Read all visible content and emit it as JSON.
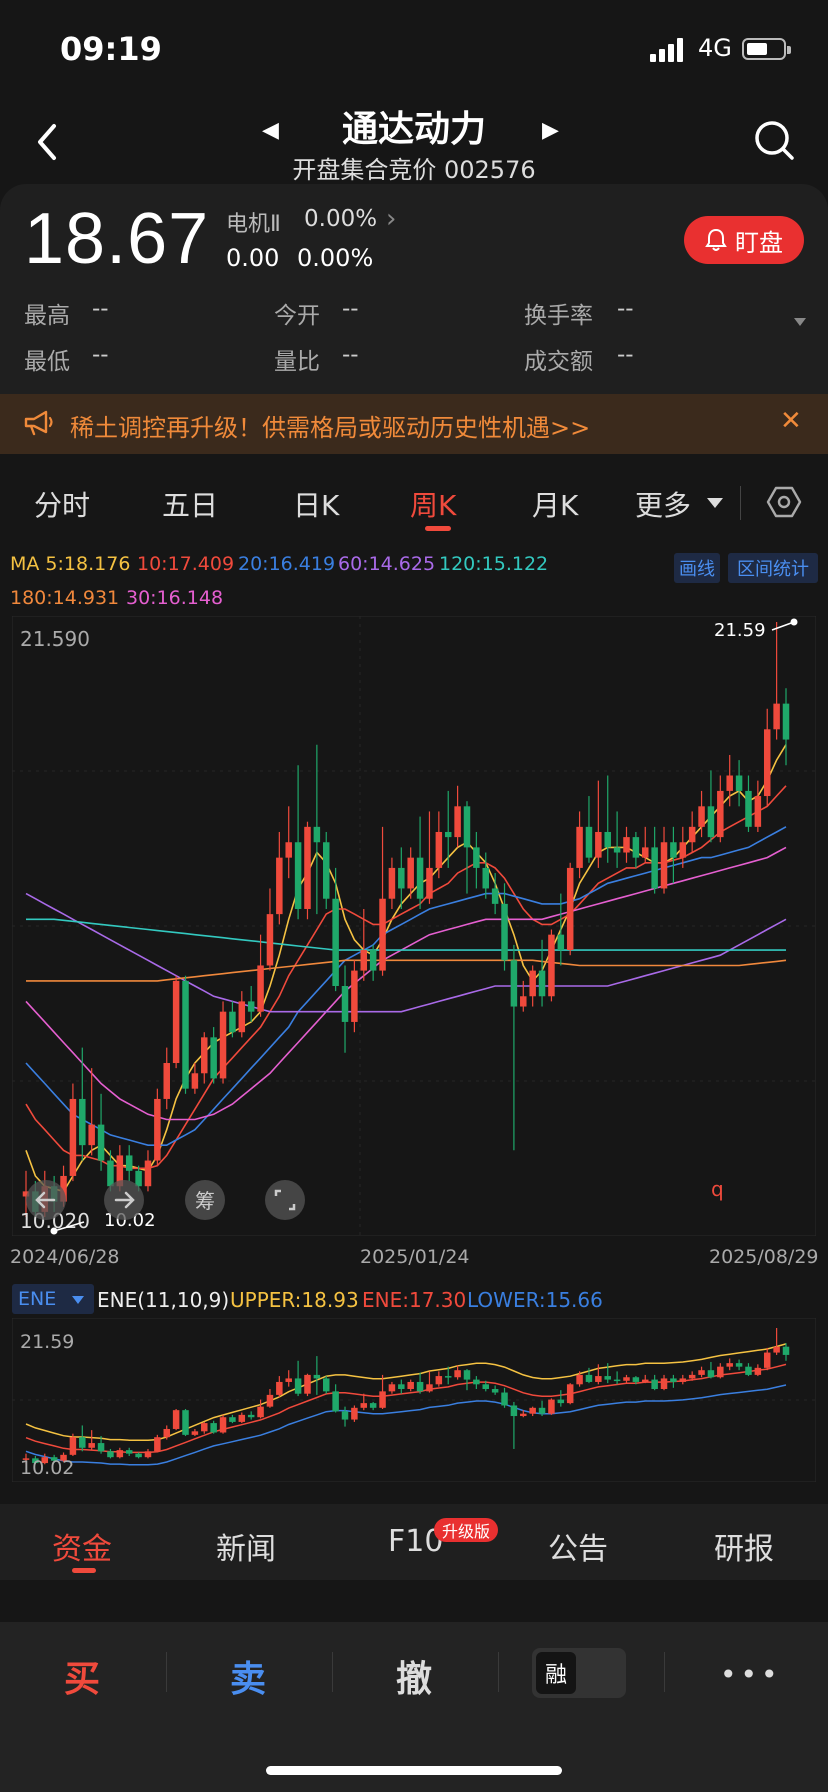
{
  "status_bar": {
    "time": "09:19",
    "network": "4G"
  },
  "header": {
    "title": "通达动力",
    "subtitle": "开盘集合竞价 002576"
  },
  "quote": {
    "price": "18.67",
    "sector_name": "电机Ⅱ",
    "sector_change": "0.00%",
    "change": "0.00",
    "change_pct": "0.00%",
    "watch_button": "盯盘",
    "stats": [
      {
        "label": "最高",
        "value": "--"
      },
      {
        "label": "今开",
        "value": "--"
      },
      {
        "label": "换手率",
        "value": "--"
      },
      {
        "label": "最低",
        "value": "--"
      },
      {
        "label": "量比",
        "value": "--"
      },
      {
        "label": "成交额",
        "value": "--"
      }
    ]
  },
  "banner": {
    "text": "稀土调控再升级！供需格局或驱动历史性机遇>>",
    "close": "✕"
  },
  "period_tabs": [
    "分时",
    "五日",
    "日K",
    "周K",
    "月K",
    "更多"
  ],
  "active_period": "周K",
  "ma_indicators": [
    {
      "label": "MA 5:18.176",
      "color": "#f5c242"
    },
    {
      "label": "10:17.409",
      "color": "#f04a3c"
    },
    {
      "label": "20:16.419",
      "color": "#3a7fe0"
    },
    {
      "label": "60:14.625",
      "color": "#a96ae8"
    },
    {
      "label": "120:15.122",
      "color": "#33c9c0"
    },
    {
      "label": "180:14.931",
      "color": "#f0883c"
    },
    {
      "label": "30:16.148",
      "color": "#e55fd0"
    }
  ],
  "chart_tools": {
    "draw": "画线",
    "range_stats": "区间统计"
  },
  "main_chart_labels": {
    "y_max": "21.590",
    "y_min": "10.020",
    "high_marker": "21.59",
    "low_marker": "10.02",
    "chip_button": "筹",
    "marker_q": "q"
  },
  "dates": [
    "2024/06/28",
    "2025/01/24",
    "2025/08/29"
  ],
  "ene": {
    "select": "ENE",
    "params": "ENE(11,10,9)",
    "upper": "UPPER:18.93",
    "mid": "ENE:17.30",
    "lower": "LOWER:15.66",
    "y_max": "21.59",
    "y_min": "10.02"
  },
  "bottom_tabs": [
    "资金",
    "新闻",
    "F10",
    "公告",
    "研报"
  ],
  "upgrade_badge": "升级版",
  "actions": {
    "buy": "买",
    "sell": "卖",
    "cancel": "撤",
    "margin": "融",
    "more": "•••"
  },
  "colors": {
    "up": "#f04a3c",
    "down": "#1fa86a",
    "accent": "#e93030",
    "link": "#4a8ef0"
  },
  "chart_data": {
    "type": "candlestick",
    "ylim": [
      10.02,
      21.59
    ],
    "candles": [
      [
        10.4,
        10.5,
        10.0,
        10.9
      ],
      [
        10.5,
        10.1,
        10.02,
        10.7
      ],
      [
        10.1,
        10.6,
        10.0,
        10.9
      ],
      [
        10.6,
        10.3,
        10.1,
        10.8
      ],
      [
        10.3,
        10.8,
        10.2,
        11.0
      ],
      [
        10.8,
        12.3,
        10.7,
        12.6
      ],
      [
        12.3,
        11.4,
        11.1,
        13.3
      ],
      [
        11.4,
        11.8,
        11.2,
        12.9
      ],
      [
        11.8,
        11.1,
        10.9,
        12.4
      ],
      [
        11.1,
        10.6,
        10.5,
        11.3
      ],
      [
        10.6,
        11.2,
        10.5,
        11.4
      ],
      [
        11.2,
        10.9,
        10.7,
        11.4
      ],
      [
        10.9,
        10.6,
        10.5,
        11.0
      ],
      [
        10.6,
        11.1,
        10.5,
        11.3
      ],
      [
        11.1,
        12.3,
        11.0,
        12.5
      ],
      [
        12.3,
        13.0,
        12.1,
        13.3
      ],
      [
        13.0,
        14.6,
        12.9,
        14.7
      ],
      [
        14.6,
        12.5,
        12.4,
        14.7
      ],
      [
        12.5,
        12.8,
        12.4,
        13.0
      ],
      [
        12.8,
        13.5,
        12.6,
        13.6
      ],
      [
        13.5,
        12.7,
        12.6,
        13.7
      ],
      [
        12.7,
        14.0,
        12.6,
        14.2
      ],
      [
        14.0,
        13.6,
        13.5,
        14.2
      ],
      [
        13.6,
        14.2,
        13.5,
        14.4
      ],
      [
        14.2,
        14.0,
        13.8,
        14.5
      ],
      [
        14.0,
        14.9,
        13.9,
        15.5
      ],
      [
        14.9,
        15.9,
        14.8,
        16.4
      ],
      [
        15.9,
        17.0,
        15.7,
        17.5
      ],
      [
        17.0,
        17.3,
        16.6,
        18.0
      ],
      [
        17.3,
        16.0,
        15.8,
        18.8
      ],
      [
        16.0,
        17.6,
        15.8,
        17.7
      ],
      [
        17.6,
        17.3,
        15.9,
        19.2
      ],
      [
        17.3,
        16.2,
        16.0,
        17.5
      ],
      [
        16.2,
        14.5,
        14.4,
        16.8
      ],
      [
        14.5,
        13.8,
        13.2,
        14.9
      ],
      [
        13.8,
        14.8,
        13.6,
        15.0
      ],
      [
        14.8,
        15.2,
        14.6,
        16.0
      ],
      [
        15.2,
        14.8,
        14.6,
        15.3
      ],
      [
        14.8,
        16.2,
        14.7,
        17.6
      ],
      [
        16.2,
        16.8,
        16.0,
        17.0
      ],
      [
        16.8,
        16.4,
        16.0,
        17.2
      ],
      [
        16.4,
        17.0,
        16.2,
        17.2
      ],
      [
        17.0,
        16.2,
        16.0,
        17.8
      ],
      [
        16.2,
        16.8,
        16.1,
        17.9
      ],
      [
        16.8,
        17.5,
        16.6,
        17.9
      ],
      [
        17.5,
        17.4,
        16.8,
        18.3
      ],
      [
        17.4,
        18.0,
        17.2,
        18.4
      ],
      [
        18.0,
        17.2,
        16.3,
        18.1
      ],
      [
        17.2,
        16.8,
        16.4,
        17.5
      ],
      [
        16.8,
        16.4,
        16.2,
        17.1
      ],
      [
        16.4,
        16.1,
        15.9,
        16.7
      ],
      [
        16.1,
        15.0,
        14.8,
        16.5
      ],
      [
        15.0,
        14.1,
        11.3,
        15.3
      ],
      [
        14.1,
        14.3,
        14.0,
        14.6
      ],
      [
        14.3,
        14.8,
        14.1,
        14.9
      ],
      [
        14.8,
        14.3,
        14.1,
        15.4
      ],
      [
        14.3,
        15.5,
        14.2,
        15.6
      ],
      [
        15.5,
        15.2,
        14.9,
        16.3
      ],
      [
        15.2,
        16.8,
        15.1,
        16.9
      ],
      [
        16.8,
        17.6,
        16.6,
        17.9
      ],
      [
        17.6,
        17.0,
        16.9,
        18.2
      ],
      [
        17.0,
        17.5,
        16.8,
        18.5
      ],
      [
        17.5,
        17.2,
        16.9,
        18.6
      ],
      [
        17.2,
        17.1,
        16.8,
        17.9
      ],
      [
        17.1,
        17.4,
        16.9,
        17.6
      ],
      [
        17.4,
        17.0,
        16.8,
        17.5
      ],
      [
        17.0,
        17.2,
        16.9,
        17.6
      ],
      [
        17.2,
        16.4,
        16.3,
        17.6
      ],
      [
        16.4,
        17.3,
        16.3,
        17.6
      ],
      [
        17.3,
        17.0,
        16.5,
        17.6
      ],
      [
        17.0,
        17.3,
        16.8,
        17.6
      ],
      [
        17.3,
        17.6,
        17.1,
        17.9
      ],
      [
        17.6,
        18.0,
        17.4,
        18.3
      ],
      [
        18.0,
        17.4,
        17.3,
        18.7
      ],
      [
        17.4,
        18.3,
        17.3,
        18.6
      ],
      [
        18.3,
        18.6,
        18.0,
        19.0
      ],
      [
        18.6,
        18.3,
        18.0,
        18.9
      ],
      [
        18.3,
        17.6,
        17.5,
        18.6
      ],
      [
        17.6,
        18.2,
        17.5,
        18.5
      ],
      [
        18.2,
        19.5,
        18.0,
        19.9
      ],
      [
        19.5,
        20.0,
        19.3,
        21.59
      ],
      [
        20.0,
        19.3,
        18.8,
        20.3
      ]
    ],
    "ma": {
      "ma5": [
        11.3,
        10.8,
        10.6,
        10.55,
        10.5,
        10.8,
        11.1,
        11.3,
        11.4,
        11.2,
        11.0,
        11.0,
        10.95,
        10.9,
        11.2,
        11.7,
        12.3,
        12.7,
        13.0,
        13.2,
        13.4,
        13.5,
        13.6,
        13.7,
        13.8,
        14.0,
        14.5,
        15.1,
        15.8,
        16.4,
        16.7,
        17.1,
        16.9,
        16.5,
        15.8,
        15.4,
        15.2,
        15.1,
        15.4,
        15.8,
        16.1,
        16.3,
        16.5,
        16.6,
        16.8,
        17.0,
        17.2,
        17.3,
        17.1,
        16.9,
        16.5,
        16.0,
        15.5,
        14.9,
        14.6,
        14.8,
        15.2,
        15.6,
        16.0,
        16.5,
        16.8,
        17.1,
        17.2,
        17.2,
        17.2,
        17.1,
        17.0,
        16.9,
        16.9,
        17.0,
        17.2,
        17.4,
        17.6,
        17.8,
        18.0,
        18.2,
        18.3,
        18.1,
        18.2,
        18.5,
        18.9,
        19.2
      ],
      "ma10": [
        12.2,
        11.9,
        11.7,
        11.5,
        11.3,
        11.2,
        11.2,
        11.15,
        11.1,
        11.0,
        11.0,
        10.95,
        10.95,
        10.95,
        11.0,
        11.2,
        11.5,
        11.8,
        12.1,
        12.4,
        12.7,
        12.9,
        13.1,
        13.3,
        13.5,
        13.7,
        14.0,
        14.3,
        14.7,
        15.0,
        15.3,
        15.6,
        15.9,
        16.0,
        16.0,
        15.9,
        15.8,
        15.7,
        15.7,
        15.8,
        15.9,
        16.0,
        16.1,
        16.3,
        16.4,
        16.5,
        16.7,
        16.8,
        16.9,
        16.9,
        16.8,
        16.6,
        16.3,
        16.0,
        15.8,
        15.7,
        15.7,
        15.8,
        15.9,
        16.1,
        16.3,
        16.5,
        16.6,
        16.7,
        16.8,
        16.8,
        16.9,
        16.9,
        16.9,
        16.95,
        17.0,
        17.1,
        17.2,
        17.35,
        17.5,
        17.6,
        17.7,
        17.8,
        17.9,
        18.0,
        18.2,
        18.4
      ],
      "ma20": [
        13.0,
        12.8,
        12.6,
        12.4,
        12.2,
        12.0,
        11.9,
        11.8,
        11.7,
        11.6,
        11.55,
        11.5,
        11.45,
        11.4,
        11.4,
        11.4,
        11.5,
        11.6,
        11.7,
        11.9,
        12.1,
        12.3,
        12.5,
        12.7,
        12.9,
        13.1,
        13.3,
        13.5,
        13.7,
        14.0,
        14.2,
        14.4,
        14.6,
        14.8,
        15.0,
        15.1,
        15.2,
        15.3,
        15.5,
        15.6,
        15.7,
        15.8,
        15.9,
        16.0,
        16.05,
        16.1,
        16.15,
        16.2,
        16.25,
        16.3,
        16.3,
        16.3,
        16.25,
        16.2,
        16.15,
        16.1,
        16.1,
        16.1,
        16.15,
        16.2,
        16.3,
        16.4,
        16.5,
        16.55,
        16.6,
        16.65,
        16.7,
        16.75,
        16.8,
        16.85,
        16.9,
        16.95,
        17.0,
        17.0,
        17.05,
        17.1,
        17.15,
        17.2,
        17.3,
        17.4,
        17.5,
        17.6
      ],
      "ma30": [
        14.2,
        14.0,
        13.8,
        13.6,
        13.4,
        13.2,
        13.0,
        12.8,
        12.6,
        12.45,
        12.3,
        12.2,
        12.1,
        12.0,
        11.95,
        11.9,
        11.9,
        11.9,
        11.9,
        11.95,
        12.0,
        12.1,
        12.2,
        12.35,
        12.5,
        12.65,
        12.8,
        13.0,
        13.2,
        13.4,
        13.6,
        13.8,
        14.0,
        14.2,
        14.4,
        14.55,
        14.7,
        14.85,
        15.0,
        15.1,
        15.2,
        15.3,
        15.4,
        15.5,
        15.55,
        15.6,
        15.65,
        15.7,
        15.75,
        15.8,
        15.8,
        15.8,
        15.8,
        15.8,
        15.8,
        15.8,
        15.85,
        15.9,
        15.95,
        16.0,
        16.05,
        16.1,
        16.15,
        16.2,
        16.25,
        16.3,
        16.35,
        16.4,
        16.45,
        16.5,
        16.55,
        16.6,
        16.65,
        16.7,
        16.75,
        16.8,
        16.85,
        16.9,
        16.95,
        17.0,
        17.1,
        17.2
      ],
      "ma60": [
        16.3,
        16.2,
        16.1,
        16.0,
        15.9,
        15.8,
        15.7,
        15.6,
        15.5,
        15.4,
        15.3,
        15.2,
        15.1,
        15.0,
        14.9,
        14.8,
        14.7,
        14.6,
        14.5,
        14.4,
        14.3,
        14.25,
        14.2,
        14.15,
        14.1,
        14.05,
        14.0,
        14.0,
        14.0,
        14.0,
        14.0,
        14.0,
        14.0,
        14.0,
        14.0,
        14.0,
        14.0,
        14.0,
        14.0,
        14.0,
        14.0,
        14.05,
        14.1,
        14.15,
        14.2,
        14.25,
        14.3,
        14.35,
        14.4,
        14.45,
        14.5,
        14.5,
        14.5,
        14.5,
        14.5,
        14.5,
        14.5,
        14.5,
        14.5,
        14.5,
        14.5,
        14.5,
        14.5,
        14.55,
        14.6,
        14.65,
        14.7,
        14.75,
        14.8,
        14.85,
        14.9,
        14.95,
        15.0,
        15.05,
        15.1,
        15.2,
        15.3,
        15.4,
        15.5,
        15.6,
        15.7,
        15.8
      ],
      "ma120": [
        15.8,
        15.8,
        15.8,
        15.8,
        15.78,
        15.76,
        15.74,
        15.72,
        15.7,
        15.68,
        15.66,
        15.64,
        15.62,
        15.6,
        15.58,
        15.56,
        15.54,
        15.52,
        15.5,
        15.48,
        15.46,
        15.44,
        15.42,
        15.4,
        15.38,
        15.36,
        15.34,
        15.32,
        15.3,
        15.28,
        15.26,
        15.24,
        15.22,
        15.2,
        15.2,
        15.2,
        15.2,
        15.2,
        15.2,
        15.2,
        15.2,
        15.2,
        15.2,
        15.2,
        15.2,
        15.2,
        15.2,
        15.2,
        15.2,
        15.2,
        15.2,
        15.2,
        15.2,
        15.2,
        15.2,
        15.2,
        15.2,
        15.2,
        15.2,
        15.2,
        15.2,
        15.2,
        15.2,
        15.2,
        15.2,
        15.2,
        15.2,
        15.2,
        15.2,
        15.2,
        15.2,
        15.2,
        15.2,
        15.2,
        15.2,
        15.2,
        15.2,
        15.2,
        15.2,
        15.2,
        15.2,
        15.2
      ],
      "ma180": [
        14.6,
        14.6,
        14.6,
        14.6,
        14.6,
        14.6,
        14.6,
        14.6,
        14.6,
        14.6,
        14.6,
        14.6,
        14.6,
        14.6,
        14.6,
        14.62,
        14.64,
        14.66,
        14.68,
        14.7,
        14.72,
        14.74,
        14.76,
        14.78,
        14.8,
        14.82,
        14.84,
        14.86,
        14.88,
        14.9,
        14.92,
        14.94,
        14.96,
        14.98,
        15.0,
        15.0,
        15.0,
        15.0,
        15.0,
        15.0,
        15.0,
        15.0,
        15.0,
        15.0,
        15.0,
        15.0,
        15.0,
        15.0,
        15.0,
        15.0,
        15.0,
        15.0,
        15.0,
        15.0,
        15.0,
        14.98,
        14.96,
        14.94,
        14.92,
        14.9,
        14.9,
        14.9,
        14.9,
        14.9,
        14.9,
        14.9,
        14.9,
        14.9,
        14.9,
        14.9,
        14.9,
        14.9,
        14.9,
        14.9,
        14.9,
        14.9,
        14.9,
        14.92,
        14.94,
        14.96,
        14.98,
        15.0
      ]
    }
  }
}
